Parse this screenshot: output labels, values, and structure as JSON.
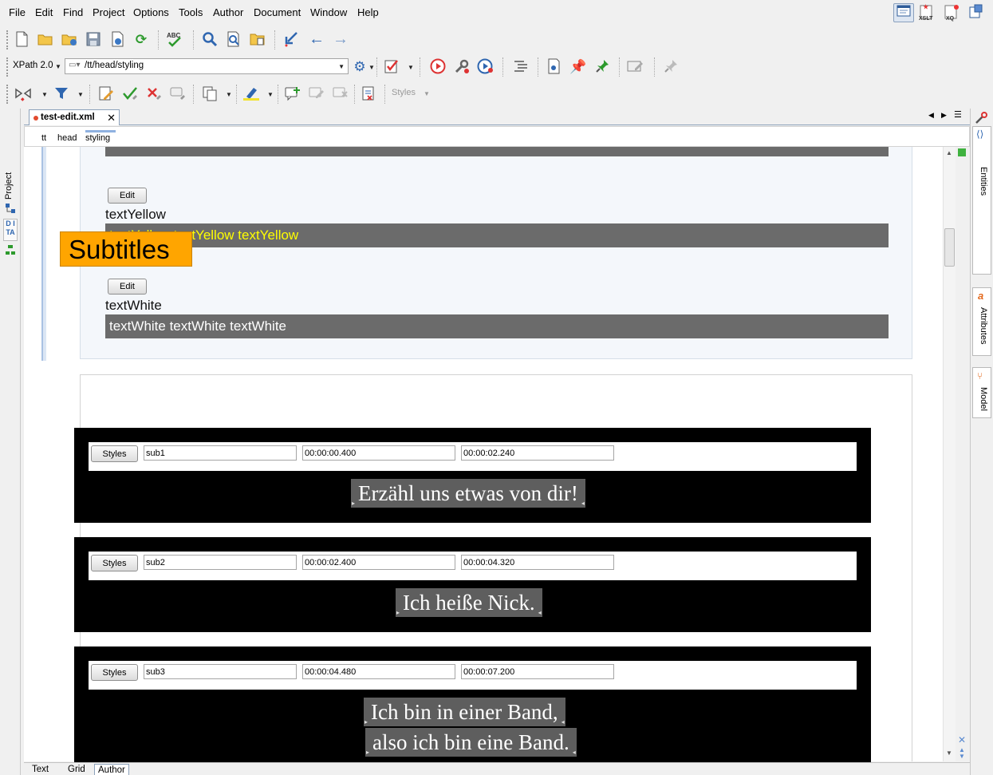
{
  "menu": [
    "File",
    "Edit",
    "Find",
    "Project",
    "Options",
    "Tools",
    "Author",
    "Document",
    "Window",
    "Help"
  ],
  "perspectives": [
    "XSLT",
    "XQ"
  ],
  "xpath": {
    "version_label": "XPath 2.0",
    "path": "/tt/head/styling"
  },
  "toolbar": {
    "styles_label": "Styles"
  },
  "side_tabs": {
    "left": [
      "Project",
      "DITA"
    ],
    "right": [
      "Entities",
      "Attributes",
      "Model"
    ]
  },
  "editor_tab": {
    "filename": "test-edit.xml"
  },
  "breadcrumb": [
    "tt",
    "head",
    "styling"
  ],
  "styles": [
    {
      "edit_label": "Edit",
      "name": "textYellow",
      "sample": "textYellow textYellow textYellow",
      "color": "#ffff00"
    },
    {
      "edit_label": "Edit",
      "name": "textWhite",
      "sample": "textWhite textWhite textWhite",
      "color": "#ffffff"
    }
  ],
  "partial_sample_color": "#ff00ff",
  "subtitles": {
    "title": "Subtitles",
    "items": [
      {
        "styles_label": "Styles",
        "id": "sub1",
        "begin": "00:00:00.400",
        "end": "00:00:02.240",
        "lines": [
          "Erzähl uns etwas von dir!"
        ]
      },
      {
        "styles_label": "Styles",
        "id": "sub2",
        "begin": "00:00:02.400",
        "end": "00:00:04.320",
        "lines": [
          "Ich heiße Nick."
        ]
      },
      {
        "styles_label": "Styles",
        "id": "sub3",
        "begin": "00:00:04.480",
        "end": "00:00:07.200",
        "lines": [
          "Ich bin in einer Band,",
          "also ich bin eine Band."
        ]
      }
    ]
  },
  "modes": [
    "Text",
    "Grid",
    "Author"
  ],
  "active_mode": "Author"
}
